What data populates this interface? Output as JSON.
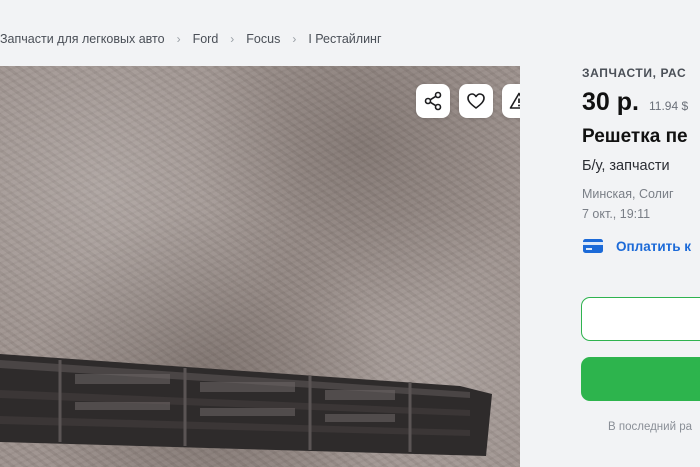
{
  "breadcrumb": {
    "items": [
      "Запчасти для легковых авто",
      "Ford",
      "Focus",
      "I Рестайлинг"
    ],
    "separator": "›"
  },
  "photo": {
    "actions": [
      "share-icon",
      "heart-icon",
      "warning-icon"
    ]
  },
  "listing": {
    "category": "ЗАПЧАСТИ, РАС",
    "price": "30 р.",
    "price_alt": "11.94 $",
    "title": "Решетка пе",
    "condition": "Б/у, запчасти",
    "location": "Минская, Солиг",
    "date": "7 окт., 19:11",
    "pay_label": "Оплатить к",
    "footer_note": "В последний ра"
  },
  "colors": {
    "accent_green": "#2db44d",
    "link_blue": "#1c6ad8"
  }
}
